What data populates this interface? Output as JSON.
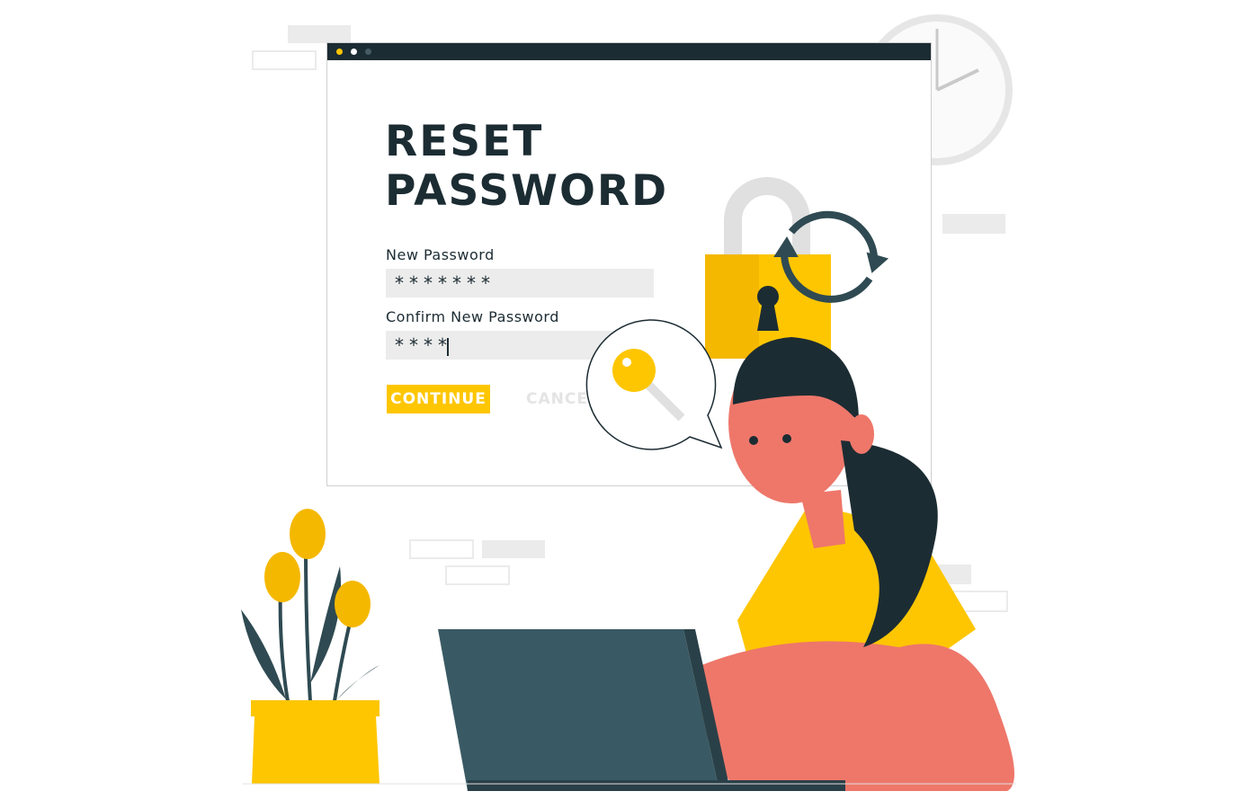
{
  "window": {
    "dots": [
      "#fec601",
      "#ffffff",
      "#455a64"
    ],
    "title_line1": "RESET",
    "title_line2": "PASSWORD",
    "new_password_label": "New Password",
    "new_password_value": "*******",
    "confirm_password_label": "Confirm New Password",
    "confirm_password_value": "****",
    "continue_label": "CONTINUE",
    "cancel_label": "CANCEL"
  },
  "colors": {
    "accent": "#fec601",
    "dark": "#1c2c33",
    "skin": "#ee776a",
    "laptop": "#395a64"
  },
  "icons": [
    "padlock-icon",
    "refresh-icon",
    "key-icon",
    "clock-icon",
    "tulip-plant"
  ]
}
